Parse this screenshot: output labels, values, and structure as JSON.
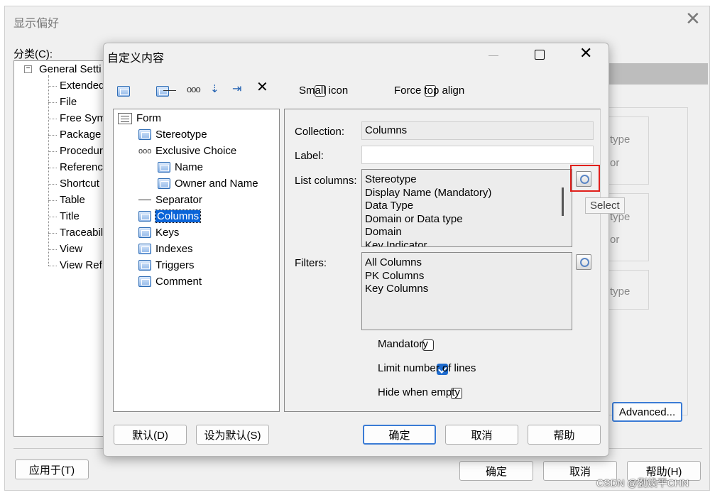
{
  "outer": {
    "title": "显示偏好",
    "category_label": "分类(C):",
    "tree_root": "General Setti",
    "tree_items": [
      "Extended",
      "File",
      "Free Sym",
      "Package",
      "Procedur",
      "Referenc",
      "Shortcut",
      "Table",
      "Title",
      "Traceabil",
      "View",
      "View Ref"
    ],
    "right_frags": [
      "type",
      "or",
      "type",
      "or",
      "type"
    ],
    "advanced_button": "Advanced...",
    "apply_button": "应用于(T)",
    "ok_button": "确定",
    "cancel_button": "取消",
    "help_button": "帮助(H)"
  },
  "dialog": {
    "title": "自定义内容",
    "small_icon_label": "Small icon",
    "force_top_align_label": "Force top align",
    "tree": {
      "root": "Form",
      "items": [
        {
          "label": "Stereotype",
          "level": 1,
          "icon": "table-icon"
        },
        {
          "label": "Exclusive Choice",
          "level": 1,
          "icon": "choice-icon"
        },
        {
          "label": "Name",
          "level": 2,
          "icon": "table-icon"
        },
        {
          "label": "Owner and Name",
          "level": 2,
          "icon": "table-icon"
        },
        {
          "label": "Separator",
          "level": 1,
          "icon": "separator-icon"
        },
        {
          "label": "Columns",
          "level": 1,
          "icon": "table-icon",
          "selected": true
        },
        {
          "label": "Keys",
          "level": 1,
          "icon": "table-icon"
        },
        {
          "label": "Indexes",
          "level": 1,
          "icon": "table-icon"
        },
        {
          "label": "Triggers",
          "level": 1,
          "icon": "table-icon"
        },
        {
          "label": "Comment",
          "level": 1,
          "icon": "table-icon"
        }
      ]
    },
    "collection_label": "Collection:",
    "collection_value": "Columns",
    "label_label": "Label:",
    "label_value": "",
    "list_columns_label": "List columns:",
    "list_columns": [
      "Stereotype",
      "Display Name (Mandatory)",
      "Data Type",
      "Domain or Data type",
      "Domain",
      "Key Indicator"
    ],
    "select_tooltip": "Select",
    "filters_label": "Filters:",
    "filters": [
      "All Columns",
      "PK Columns",
      "Key Columns"
    ],
    "mandatory_label": "Mandatory",
    "mandatory_checked": false,
    "limit_lines_label": "Limit number of lines",
    "limit_lines_checked": true,
    "hide_empty_label": "Hide when empty",
    "hide_empty_checked": false,
    "default_button": "默认(D)",
    "set_default_button": "设为默认(S)",
    "ok_button": "确定",
    "cancel_button": "取消",
    "help_button": "帮助"
  },
  "watermark": "CSDN @劉煥平CHN",
  "colors": {
    "accent": "#0078d7",
    "highlight": "#e0201b",
    "selection": "#0a64d8"
  }
}
